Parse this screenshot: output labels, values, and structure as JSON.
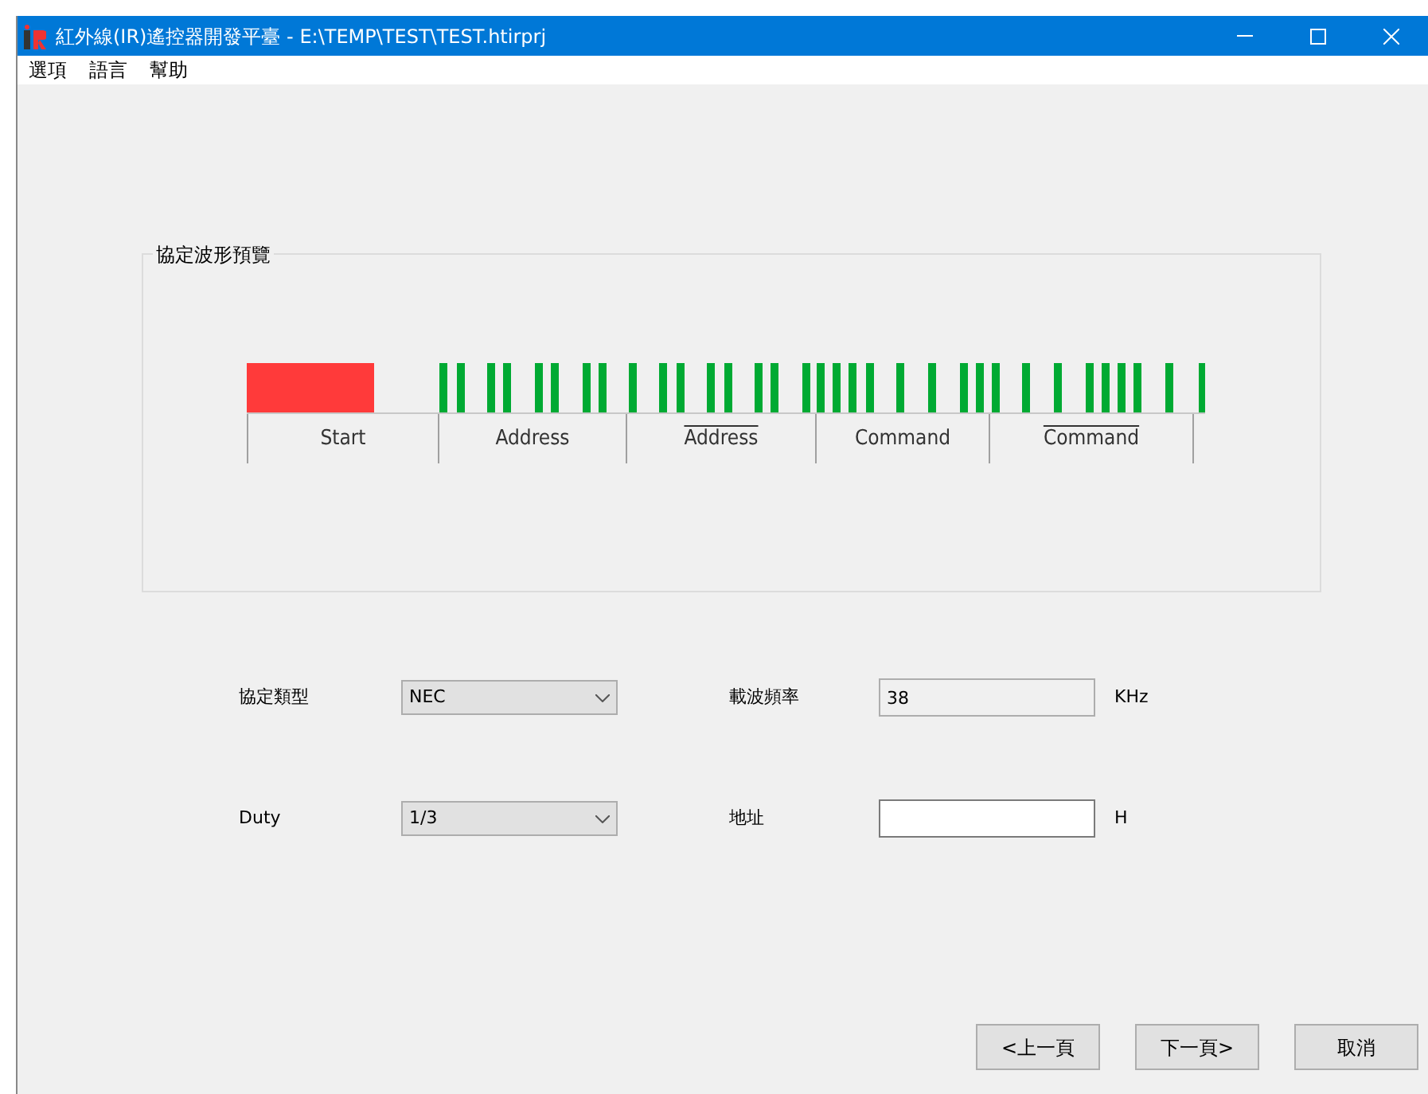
{
  "window": {
    "title": "紅外線(IR)遙控器開發平臺 - E:\\TEMP\\TEST\\TEST.htirprj"
  },
  "menu": [
    "選項",
    "語言",
    "幫助"
  ],
  "preview": {
    "title": "協定波形預覽",
    "segments": [
      {
        "label": "Start",
        "inverted": false
      },
      {
        "label": "Address",
        "inverted": false
      },
      {
        "label": "Address",
        "inverted": true
      },
      {
        "label": "Command",
        "inverted": false
      },
      {
        "label": "Command",
        "inverted": true
      }
    ]
  },
  "form": [
    {
      "label": "協定類型",
      "kind": "select",
      "value": "NEC"
    },
    {
      "label": "載波頻率",
      "kind": "text",
      "value": "38",
      "unit": "KHz",
      "disabled": true
    },
    {
      "label": "Duty",
      "kind": "select",
      "value": "1/3"
    },
    {
      "label": "地址",
      "kind": "text",
      "unit": "H",
      "disabled": false
    }
  ],
  "buttons": [
    "<上一頁",
    "下一頁>",
    "取消"
  ]
}
